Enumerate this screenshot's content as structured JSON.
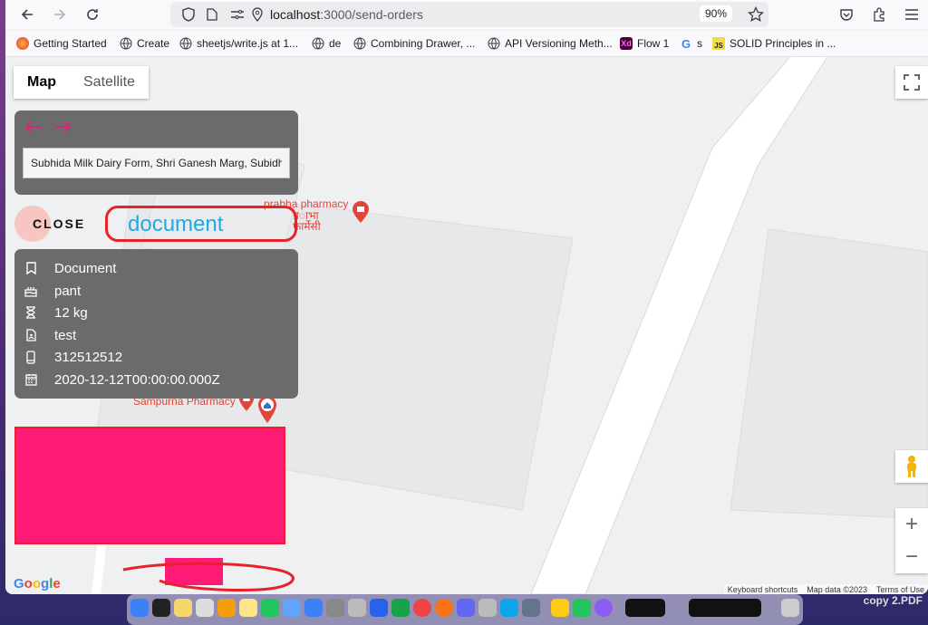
{
  "browser": {
    "url_host": "localhost",
    "url_path": ":3000/send-orders",
    "zoom": "90%"
  },
  "bookmarks": [
    {
      "label": "Getting Started",
      "icon": "firefox-icon"
    },
    {
      "label": "Create",
      "icon": "globe-icon"
    },
    {
      "label": "sheetjs/write.js at 1...",
      "icon": "globe-icon"
    },
    {
      "label": "de",
      "icon": "globe-icon"
    },
    {
      "label": "Combining Drawer, ...",
      "icon": "globe-icon"
    },
    {
      "label": "API Versioning Meth...",
      "icon": "globe-icon"
    },
    {
      "label": "Flow 1",
      "icon": "xd-icon"
    },
    {
      "label": "s",
      "icon": "google-icon"
    },
    {
      "label": "SOLID Principles in ...",
      "icon": "js-icon"
    }
  ],
  "map": {
    "type_map": "Map",
    "type_satellite": "Satellite",
    "poi_prabha_en": "prabha pharmacy",
    "poi_prabha_hi_1": "प्र◌ाभा",
    "poi_prabha_hi_2": "फार्मेसी",
    "poi_sampurna": "Sampurna Pharmacy",
    "google": "Google",
    "keyboard_shortcuts": "Keyboard shortcuts",
    "map_data": "Map data ©2023",
    "terms": "Terms of Use"
  },
  "panel": {
    "address_value": "Subhida Milk Dairy Form, Shri Ganesh Marg, Subidha",
    "close_label": "CLOSE",
    "annotation": "document"
  },
  "details": [
    {
      "icon": "bookmark-icon",
      "text": "Document"
    },
    {
      "icon": "cake-icon",
      "text": "pant"
    },
    {
      "icon": "hourglass-icon",
      "text": "12 kg"
    },
    {
      "icon": "file-icon",
      "text": "test"
    },
    {
      "icon": "phone-icon",
      "text": "312512512"
    },
    {
      "icon": "calendar-icon",
      "text": "2020-12-12T00:00:00.000Z"
    }
  ],
  "dock": {
    "label": "copy 2.PDF"
  },
  "colors": {
    "accent_pink": "#e0207a",
    "redaction": "#ff1a75",
    "annotation_red": "#e8212a",
    "annotation_blue": "#21a9e1",
    "panel_gray": "#6b6b6b"
  }
}
